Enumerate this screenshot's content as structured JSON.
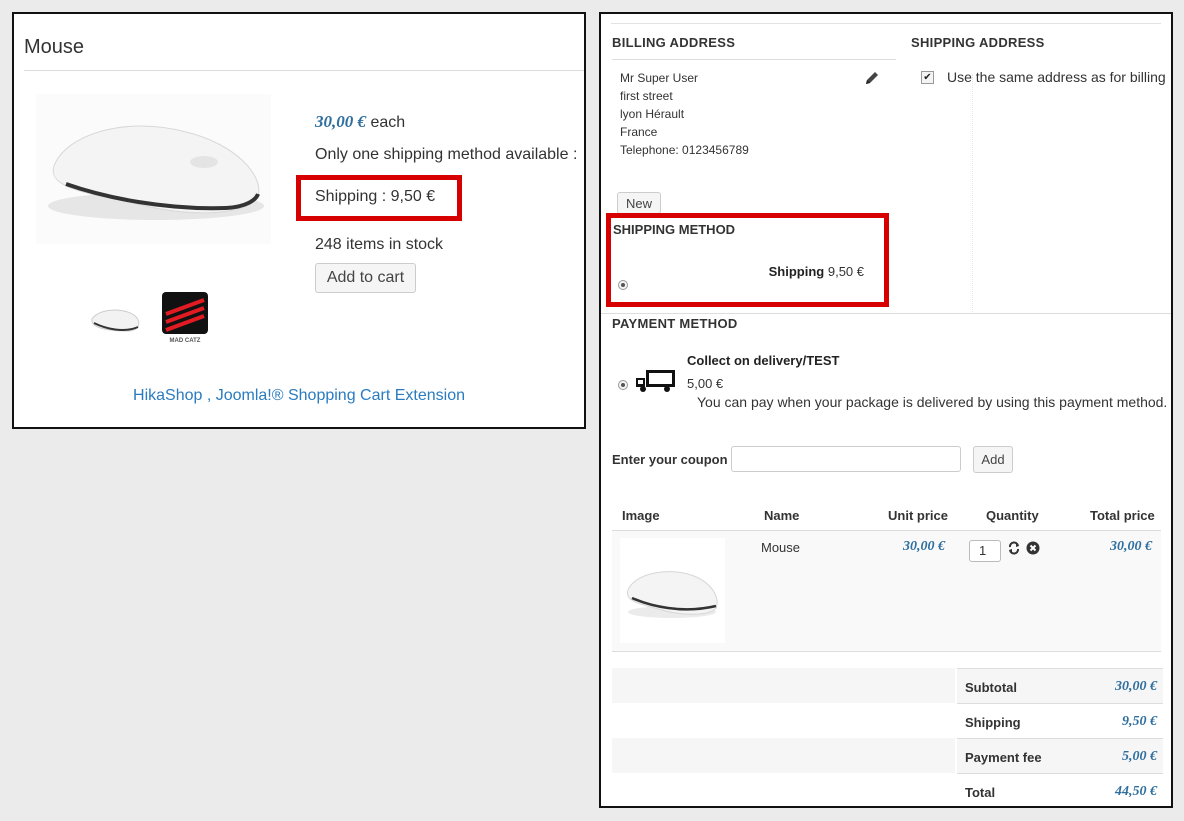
{
  "product_page": {
    "title": "Mouse",
    "price": "30,00 €",
    "price_suffix": " each",
    "shipping_note": "Only one shipping method available :",
    "shipping_text": "Shipping : 9,50 €",
    "stock": "248 items in stock",
    "add_to_cart": "Add to cart",
    "footer_link": "HikaShop , Joomla!® Shopping Cart Extension",
    "thumbnail_brand": "MAD CATZ"
  },
  "checkout": {
    "billing": {
      "heading": "BILLING ADDRESS",
      "lines": [
        "Mr Super User",
        "first street",
        "lyon Hérault",
        "France",
        "Telephone: 0123456789"
      ],
      "new_button": "New"
    },
    "shipping_address": {
      "heading": "SHIPPING ADDRESS",
      "same_as_billing_label": "Use the same address as for billing",
      "same_as_billing_checked": true
    },
    "shipping_method": {
      "heading": "SHIPPING METHOD",
      "name": "Shipping",
      "price": " 9,50 €",
      "selected": true
    },
    "payment_method": {
      "heading": "PAYMENT METHOD",
      "name": "Collect on delivery/TEST",
      "price": "5,00 €",
      "description": "You can pay when your package is delivered by using this payment method.",
      "selected": true
    },
    "coupon": {
      "label": "Enter your coupon",
      "value": "",
      "add_button": "Add"
    },
    "cart": {
      "columns": [
        "Image",
        "Name",
        "Unit price",
        "Quantity",
        "Total price"
      ],
      "items": [
        {
          "name": "Mouse",
          "unit_price": "30,00 €",
          "quantity": "1",
          "total_price": "30,00 €"
        }
      ]
    },
    "totals": [
      {
        "label": "Subtotal",
        "value": "30,00 €"
      },
      {
        "label": "Shipping",
        "value": "9,50 €"
      },
      {
        "label": "Payment fee",
        "value": "5,00 €"
      },
      {
        "label": "Total",
        "value": "44,50 €"
      }
    ]
  },
  "colors": {
    "highlight_box": "#d60000",
    "price_blue": "#2f6f9f",
    "link_blue": "#2a7bbf",
    "page_background": "#ebebeb"
  }
}
